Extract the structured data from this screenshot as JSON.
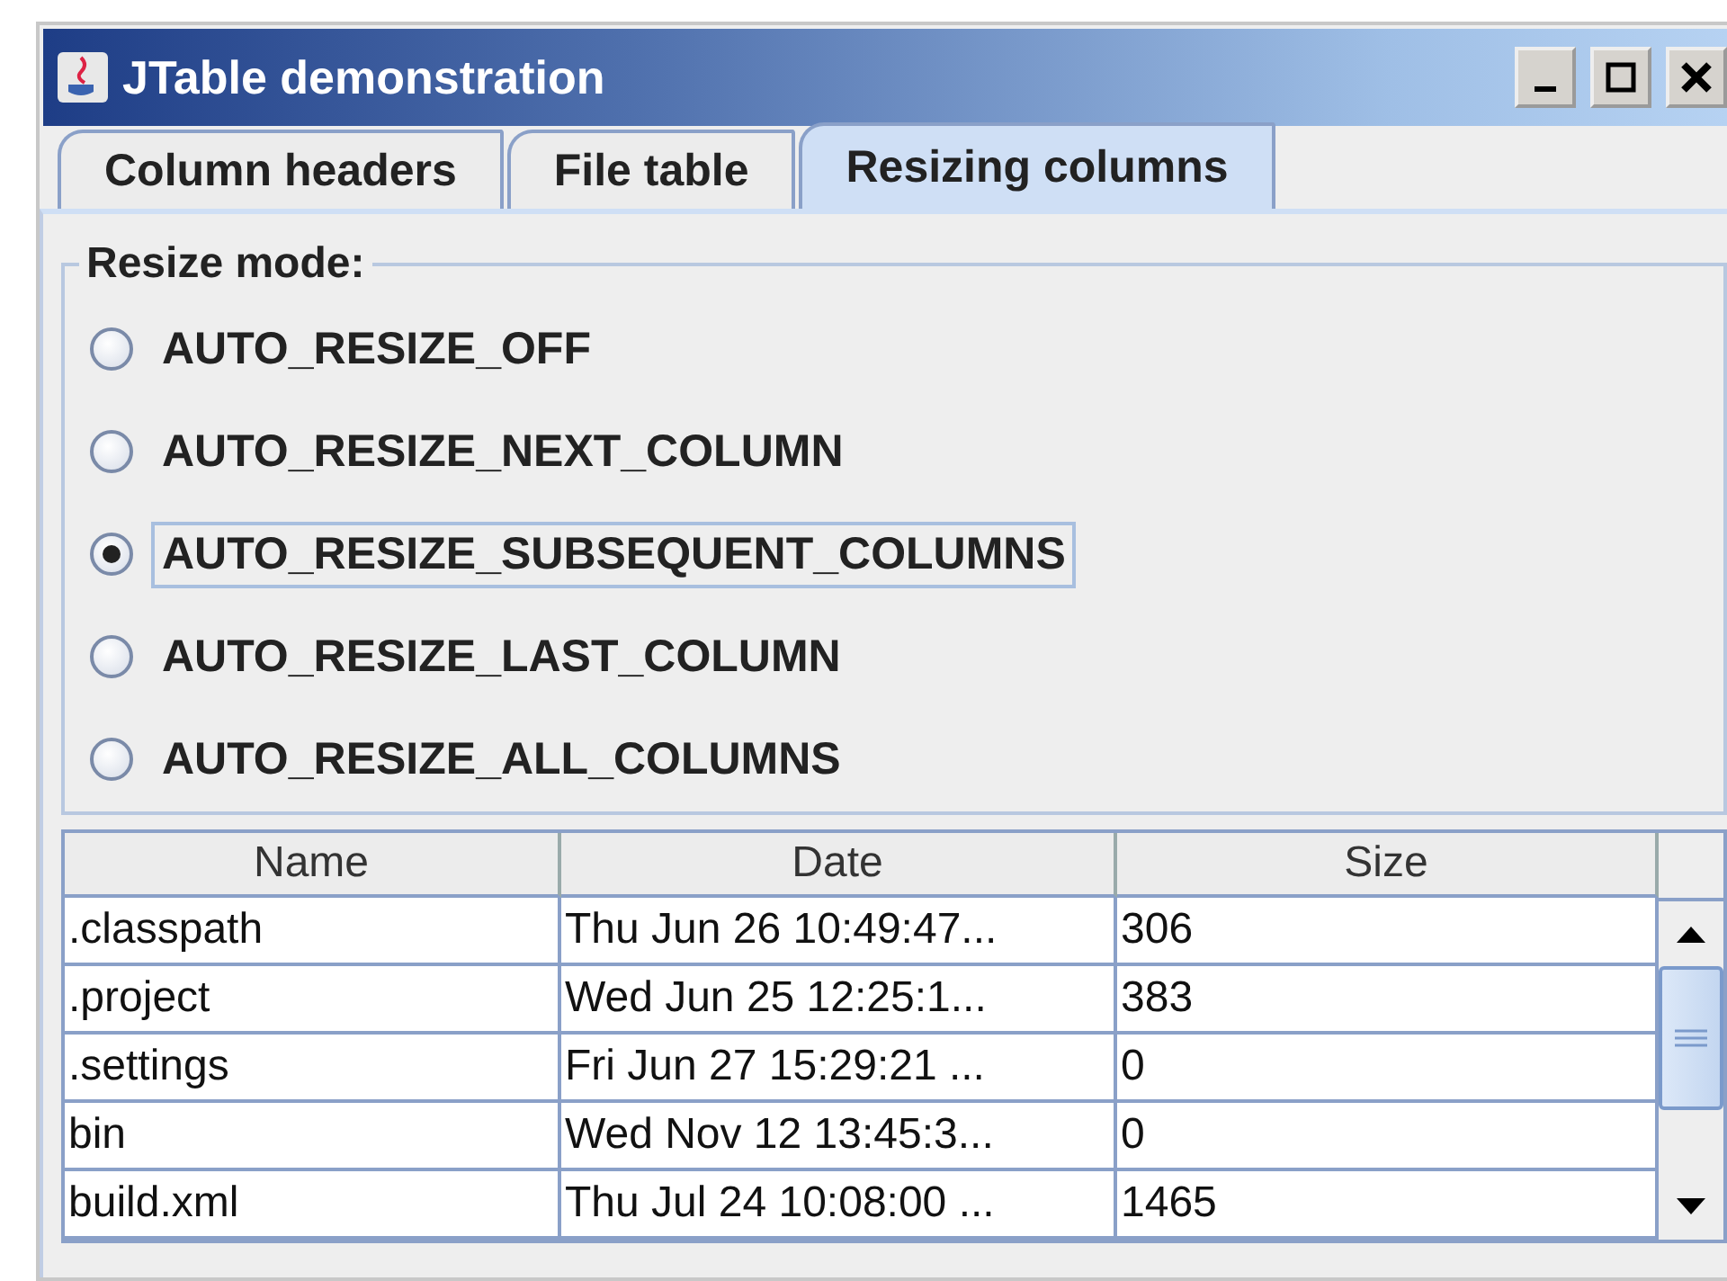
{
  "window": {
    "title": "JTable demonstration"
  },
  "tabs": [
    {
      "label": "Column headers",
      "selected": false
    },
    {
      "label": "File table",
      "selected": false
    },
    {
      "label": "Resizing columns",
      "selected": true
    }
  ],
  "resize_mode": {
    "title": "Resize mode:",
    "options": [
      {
        "label": "AUTO_RESIZE_OFF",
        "selected": false,
        "focused": false
      },
      {
        "label": "AUTO_RESIZE_NEXT_COLUMN",
        "selected": false,
        "focused": false
      },
      {
        "label": "AUTO_RESIZE_SUBSEQUENT_COLUMNS",
        "selected": true,
        "focused": true
      },
      {
        "label": "AUTO_RESIZE_LAST_COLUMN",
        "selected": false,
        "focused": false
      },
      {
        "label": "AUTO_RESIZE_ALL_COLUMNS",
        "selected": false,
        "focused": false
      }
    ]
  },
  "table": {
    "columns": [
      "Name",
      "Date",
      "Size"
    ],
    "rows": [
      [
        ".classpath",
        "Thu Jun 26 10:49:47...",
        "306"
      ],
      [
        ".project",
        "Wed Jun 25 12:25:1...",
        "383"
      ],
      [
        ".settings",
        "Fri Jun 27 15:29:21 ...",
        "0"
      ],
      [
        "bin",
        "Wed Nov 12 13:45:3...",
        "0"
      ],
      [
        "build.xml",
        "Thu Jul 24 10:08:00 ...",
        "1465"
      ]
    ]
  }
}
